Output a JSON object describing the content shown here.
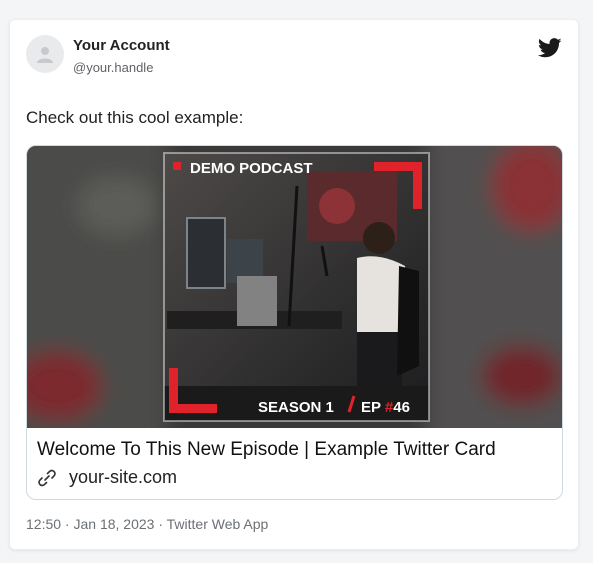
{
  "account": {
    "name": "Your Account",
    "handle": "@your.handle"
  },
  "tweet": {
    "text": "Check out this cool example:"
  },
  "card": {
    "image": {
      "podcast_name": "DEMO PODCAST",
      "season_label": "SEASON 1",
      "separator": "/",
      "episode_prefix": "EP",
      "episode_hash": "#",
      "episode_number": "46"
    },
    "title": "Welcome To This New Episode | Example Twitter Card",
    "domain": "your-site.com"
  },
  "footer": {
    "meta": "12:50 · Jan 18, 2023 · Twitter Web App"
  },
  "icons": {
    "avatar": "user-placeholder-icon",
    "brand": "twitter-bird-icon",
    "link": "link-icon"
  },
  "colors": {
    "accent_red": "#e0222a",
    "twitter_icon": "#1a1a1a"
  }
}
